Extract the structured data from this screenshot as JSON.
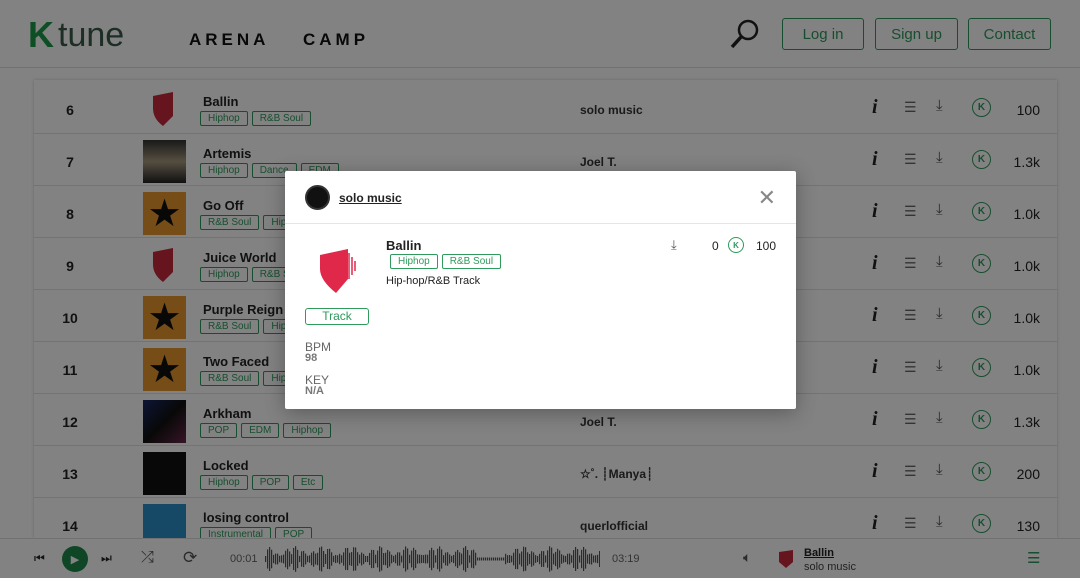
{
  "header": {
    "logo": "tune",
    "logo_letter": "K",
    "nav": [
      "ARENA",
      "CAMP"
    ],
    "buttons": [
      "Log in",
      "Sign up",
      "Contact"
    ]
  },
  "colors": {
    "accent": "#2e9a5c",
    "logo_red": "#e0284a"
  },
  "rows": [
    {
      "rank": "6",
      "title": "Ballin",
      "tags": [
        "Hiphop",
        "R&B Soul"
      ],
      "artist": "solo music",
      "count": "100",
      "thumb": "logo"
    },
    {
      "rank": "7",
      "title": "Artemis",
      "tags": [
        "Hiphop",
        "Dance",
        "EDM"
      ],
      "artist": "Joel T.",
      "count": "1.3k",
      "thumb": "photo"
    },
    {
      "rank": "8",
      "title": "Go Off",
      "tags": [
        "R&B Soul",
        "Hiphop"
      ],
      "artist": "",
      "count": "1.0k",
      "thumb": "star"
    },
    {
      "rank": "9",
      "title": "Juice World",
      "tags": [
        "Hiphop",
        "R&B Soul"
      ],
      "artist": "",
      "count": "1.0k",
      "thumb": "logo"
    },
    {
      "rank": "10",
      "title": "Purple Reign",
      "tags": [
        "R&B Soul",
        "Hiphop"
      ],
      "artist": "",
      "count": "1.0k",
      "thumb": "star"
    },
    {
      "rank": "11",
      "title": "Two Faced",
      "tags": [
        "R&B Soul",
        "Hiphop"
      ],
      "artist": "",
      "count": "1.0k",
      "thumb": "star"
    },
    {
      "rank": "12",
      "title": "Arkham",
      "tags": [
        "POP",
        "EDM",
        "Hiphop"
      ],
      "artist": "Joel T.",
      "count": "1.3k",
      "thumb": "dark"
    },
    {
      "rank": "13",
      "title": "Locked",
      "tags": [
        "Hiphop",
        "POP",
        "Etc"
      ],
      "artist": "☆˚. ┊Manya┊",
      "count": "200",
      "thumb": "black"
    },
    {
      "rank": "14",
      "title": "losing control",
      "tags": [
        "Instrumental",
        "POP"
      ],
      "artist": "querlofficial",
      "count": "130",
      "thumb": "blue"
    }
  ],
  "player": {
    "elapsed": "00:01",
    "duration": "03:19",
    "title": "Ballin",
    "artist": "solo music",
    "progress": 0.005
  },
  "modal": {
    "owner": "solo music",
    "title": "Ballin",
    "tags": [
      "Hiphop",
      "R&B Soul"
    ],
    "description": "Hip-hop/R&B Track",
    "type_badge": "Track",
    "downloads": "0",
    "price": "100",
    "bpm_label": "BPM",
    "bpm": "98",
    "key_label": "KEY",
    "key": "N/A"
  }
}
